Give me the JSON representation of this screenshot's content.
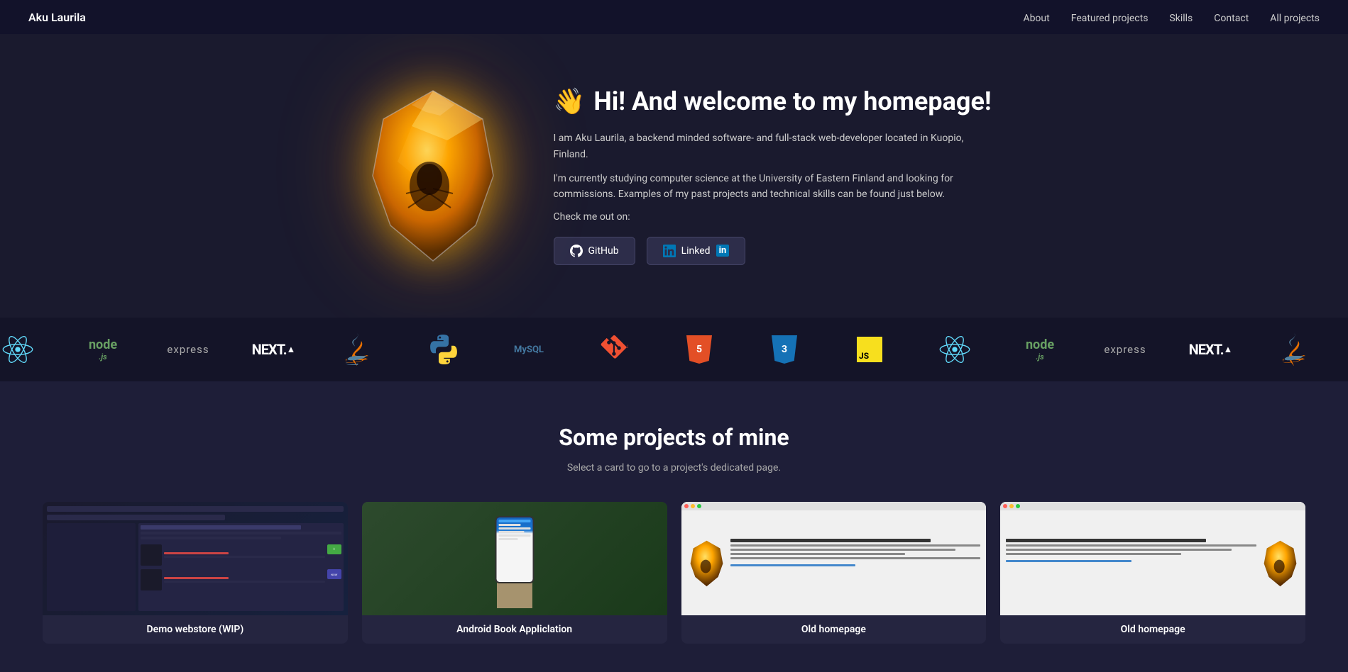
{
  "nav": {
    "logo": "Aku Laurila",
    "links": [
      {
        "label": "About",
        "href": "#about"
      },
      {
        "label": "Featured projects",
        "href": "#featured"
      },
      {
        "label": "Skills",
        "href": "#skills"
      },
      {
        "label": "Contact",
        "href": "#contact"
      },
      {
        "label": "All projects",
        "href": "#all"
      }
    ]
  },
  "hero": {
    "wave_emoji": "👋",
    "title": "Hi! And welcome to my homepage!",
    "description1": "I am Aku Laurila, a backend minded software- and full-stack web-developer located in Kuopio, Finland.",
    "description2": "I'm currently studying computer science at the University of Eastern Finland and looking for commissions. Examples of my past projects and technical skills can be found just below.",
    "check_out_label": "Check me out on:",
    "github_label": "GitHub",
    "linkedin_label": "Linked",
    "linkedin_in": "in"
  },
  "tech_ticker": {
    "items": [
      {
        "name": "react",
        "label": ""
      },
      {
        "name": "nodejs",
        "label": "node"
      },
      {
        "name": "express",
        "label": "express"
      },
      {
        "name": "next",
        "label": "NEXT.js"
      },
      {
        "name": "java",
        "label": "Java"
      },
      {
        "name": "python",
        "label": ""
      },
      {
        "name": "mysql",
        "label": "MySQL"
      },
      {
        "name": "git",
        "label": "git"
      },
      {
        "name": "html5",
        "label": ""
      },
      {
        "name": "css3",
        "label": ""
      },
      {
        "name": "js",
        "label": "JS"
      }
    ]
  },
  "projects": {
    "title": "Some projects of mine",
    "subtitle": "Select a card to go to a project's dedicated page.",
    "cards": [
      {
        "label": "Demo webstore (WIP)"
      },
      {
        "label": "Android Book Appliclation"
      },
      {
        "label": "Old homepage"
      },
      {
        "label": "Old homepage"
      }
    ]
  }
}
